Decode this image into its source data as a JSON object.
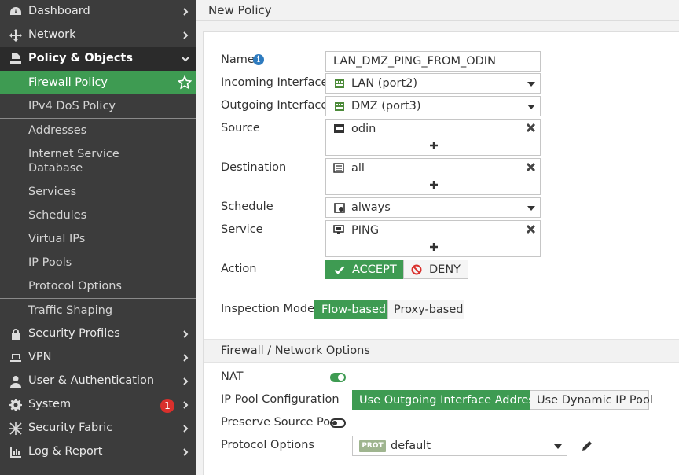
{
  "sidebar": {
    "items": [
      {
        "label": "Dashboard",
        "icon": "dashboard-icon"
      },
      {
        "label": "Network",
        "icon": "network-icon"
      },
      {
        "label": "Policy & Objects",
        "icon": "policy-icon"
      },
      {
        "label": "Security Profiles",
        "icon": "lock-icon"
      },
      {
        "label": "VPN",
        "icon": "laptop-icon"
      },
      {
        "label": "User & Authentication",
        "icon": "user-icon"
      },
      {
        "label": "System",
        "icon": "gear-icon",
        "badge": "1"
      },
      {
        "label": "Security Fabric",
        "icon": "fabric-icon"
      },
      {
        "label": "Log & Report",
        "icon": "chart-icon"
      }
    ],
    "sub_items": [
      {
        "label": "Firewall Policy"
      },
      {
        "label": "IPv4 DoS Policy"
      },
      {
        "label": "Addresses"
      },
      {
        "label": "Internet Service Database"
      },
      {
        "label": "Services"
      },
      {
        "label": "Schedules"
      },
      {
        "label": "Virtual IPs"
      },
      {
        "label": "IP Pools"
      },
      {
        "label": "Protocol Options"
      },
      {
        "label": "Traffic Shaping"
      }
    ]
  },
  "page": {
    "title": "New Policy"
  },
  "form": {
    "name": {
      "label": "Name",
      "value": "LAN_DMZ_PING_FROM_ODIN"
    },
    "incoming": {
      "label": "Incoming Interface",
      "value": "LAN (port2)"
    },
    "outgoing": {
      "label": "Outgoing Interface",
      "value": "DMZ (port3)"
    },
    "source": {
      "label": "Source",
      "value": "odin"
    },
    "destination": {
      "label": "Destination",
      "value": "all"
    },
    "schedule": {
      "label": "Schedule",
      "value": "always"
    },
    "service": {
      "label": "Service",
      "value": "PING"
    },
    "action": {
      "label": "Action",
      "accept": "ACCEPT",
      "deny": "DENY",
      "selected": "ACCEPT"
    },
    "inspection": {
      "label": "Inspection Mode",
      "flow": "Flow-based",
      "proxy": "Proxy-based",
      "selected": "Flow-based"
    }
  },
  "fw_section": {
    "title": "Firewall / Network Options",
    "nat": {
      "label": "NAT",
      "enabled": true
    },
    "ip_pool": {
      "label": "IP Pool Configuration",
      "outgoing": "Use Outgoing Interface Address",
      "dynamic": "Use Dynamic IP Pool",
      "selected": "Use Outgoing Interface Address"
    },
    "preserve": {
      "label": "Preserve Source Port",
      "enabled": false
    },
    "protocol": {
      "label": "Protocol Options",
      "tag": "PROT",
      "value": "default"
    }
  },
  "colors": {
    "accent": "#3e9b52",
    "sidebar_bg": "#3c3c3c",
    "badge": "#d9302c",
    "info": "#2e7bbf"
  }
}
